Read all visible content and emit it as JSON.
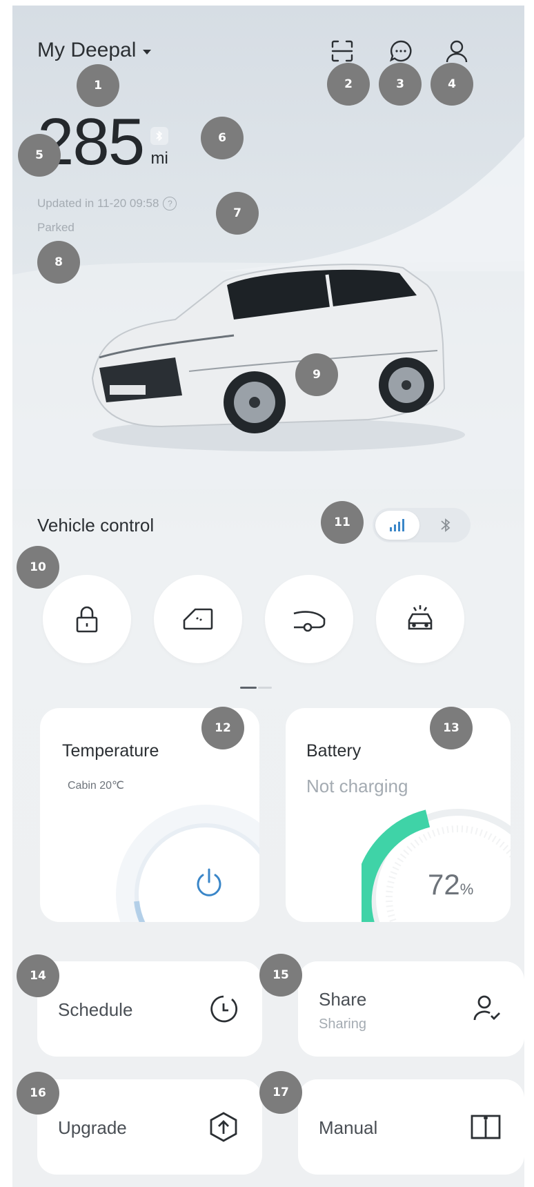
{
  "header": {
    "title": "My Deepal"
  },
  "range": {
    "value": "285",
    "unit": "mi"
  },
  "updated": {
    "text": "Updated in 11-20 09:58"
  },
  "status": {
    "text": "Parked"
  },
  "vehicle_control": {
    "title": "Vehicle control"
  },
  "temperature_card": {
    "title": "Temperature",
    "subtitle": "Cabin 20℃"
  },
  "battery_card": {
    "title": "Battery",
    "subtitle": "Not charging",
    "percent": "72",
    "percent_unit": "%"
  },
  "tiles": {
    "schedule": {
      "label": "Schedule"
    },
    "share": {
      "label": "Share",
      "sub": "Sharing"
    },
    "upgrade": {
      "label": "Upgrade"
    },
    "manual": {
      "label": "Manual"
    }
  },
  "callouts": [
    "1",
    "2",
    "3",
    "4",
    "5",
    "6",
    "7",
    "8",
    "9",
    "10",
    "11",
    "12",
    "13",
    "14",
    "15",
    "16",
    "17"
  ],
  "colors": {
    "accent": "#3a86c8",
    "battery": "#3fd3a7",
    "callout": "#7c7c7c"
  }
}
